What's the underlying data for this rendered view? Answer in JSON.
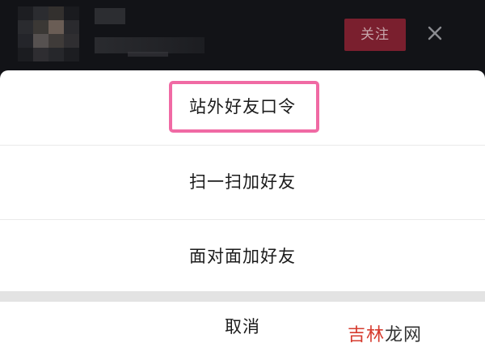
{
  "background": {
    "follow_button_label": "关注",
    "close_icon": "close-icon"
  },
  "sheet": {
    "items": [
      {
        "label": "站外好友口令",
        "highlighted": true
      },
      {
        "label": "扫一扫加好友"
      },
      {
        "label": "面对面加好友"
      }
    ],
    "cancel_label": "取消"
  },
  "highlight_color": "#f06aa4",
  "watermark": {
    "part1": "吉林",
    "part2": "龙网"
  }
}
